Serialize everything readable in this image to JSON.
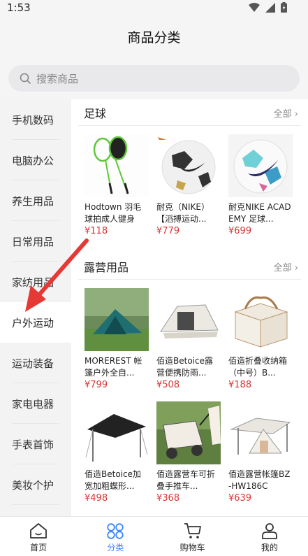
{
  "status": {
    "time": "1:53"
  },
  "header": {
    "title": "商品分类"
  },
  "search": {
    "placeholder": "搜索商品"
  },
  "sidebar": {
    "items": [
      {
        "label": "手机数码"
      },
      {
        "label": "电脑办公"
      },
      {
        "label": "养生用品"
      },
      {
        "label": "日常用品"
      },
      {
        "label": "家纺用品"
      },
      {
        "label": "户外运动"
      },
      {
        "label": "运动装备"
      },
      {
        "label": "家电电器"
      },
      {
        "label": "手表首饰"
      },
      {
        "label": "美妆个护"
      }
    ],
    "active_index": 5
  },
  "sections": [
    {
      "title": "足球",
      "more": "全部",
      "products": [
        {
          "name": "Hodtown 羽毛球拍成人健身",
          "price": "¥118"
        },
        {
          "name": "耐克（NIKE）【滔搏运动...",
          "price": "¥779"
        },
        {
          "name": "耐克NIKE ACADEMY 足球...",
          "price": "¥699"
        }
      ]
    },
    {
      "title": "露营用品",
      "more": "全部",
      "products": [
        {
          "name": "MOREREST 帐篷户外全自...",
          "price": "¥799"
        },
        {
          "name": "佰造Betoice露营便携防雨...",
          "price": "¥508"
        },
        {
          "name": "佰造折叠收纳箱（中号）B...",
          "price": "¥188"
        },
        {
          "name": "佰造Betoice加宽加粗蝶形...",
          "price": "¥498"
        },
        {
          "name": "佰造露营车可折叠手推车...",
          "price": "¥368"
        },
        {
          "name": "佰造露营帐篷BZ-HW186C",
          "price": "¥639"
        }
      ]
    }
  ],
  "tabbar": {
    "items": [
      {
        "label": "首页"
      },
      {
        "label": "分类"
      },
      {
        "label": "购物车"
      },
      {
        "label": "我的"
      }
    ],
    "active_index": 1
  },
  "colors": {
    "accent": "#3a86ff",
    "price": "#d33333",
    "annotation": "#e53935"
  }
}
